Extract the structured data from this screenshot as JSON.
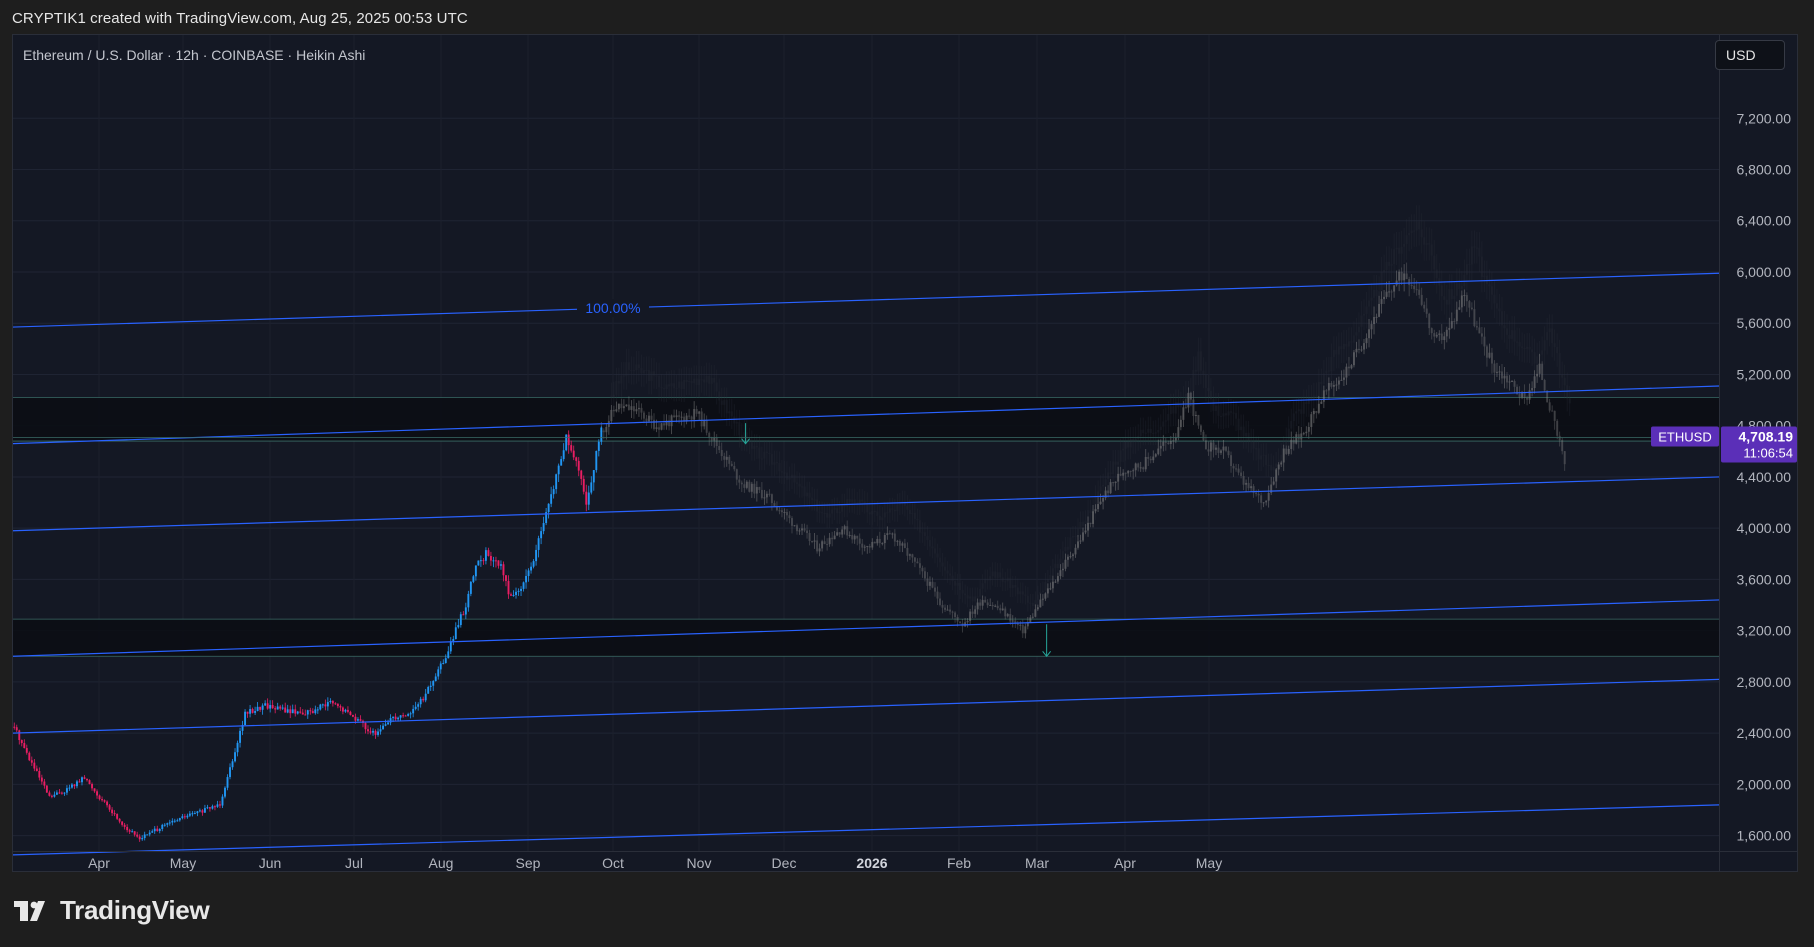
{
  "header": {
    "caption": "CRYPTIK1 created with TradingView.com, Aug 25, 2025 00:53 UTC"
  },
  "chart": {
    "symbol_title": "Ethereum / U.S. Dollar · 12h · COINBASE · Heikin Ashi",
    "currency_button": "USD",
    "price_tag_symbol": "ETHUSD",
    "price_tag_value": "4,708.19",
    "price_tag_countdown": "11:06:54",
    "fib_label": "100.00%",
    "colors": {
      "background": "#141824",
      "channel_line": "#2962ff",
      "up_candle": "#2196f3",
      "down_candle": "#e91e63",
      "projection": "#8c8c8c",
      "price_tag": "#5b2fb8"
    }
  },
  "chart_data": {
    "type": "candlestick",
    "title": "Ethereum / U.S. Dollar · 12h · COINBASE · Heikin Ashi",
    "y_ticks": [
      7200,
      6800,
      6400,
      6000,
      5600,
      5200,
      4800,
      4400,
      4000,
      3600,
      3200,
      2800,
      2400,
      2000,
      1600
    ],
    "y_tick_labels": [
      "7,200.00",
      "6,800.00",
      "6,400.00",
      "6,000.00",
      "5,600.00",
      "5,200.00",
      "4,800.00",
      "4,400.00",
      "4,000.00",
      "3,600.00",
      "3,200.00",
      "2,800.00",
      "2,400.00",
      "2,000.00",
      "1,600.00"
    ],
    "ylim": [
      1480,
      7850
    ],
    "x_labels": [
      "Apr",
      "May",
      "Jun",
      "Jul",
      "Aug",
      "Sep",
      "Oct",
      "Nov",
      "Dec",
      "2026",
      "Feb",
      "Mar",
      "Apr",
      "May"
    ],
    "last_price": 4708.19,
    "actual_path": [
      [
        0,
        2450
      ],
      [
        6,
        2200
      ],
      [
        14,
        1900
      ],
      [
        20,
        1950
      ],
      [
        28,
        2050
      ],
      [
        36,
        1850
      ],
      [
        45,
        1650
      ],
      [
        50,
        1580
      ],
      [
        60,
        1680
      ],
      [
        68,
        1750
      ],
      [
        76,
        1800
      ],
      [
        82,
        1850
      ],
      [
        92,
        2550
      ],
      [
        100,
        2620
      ],
      [
        110,
        2570
      ],
      [
        118,
        2560
      ],
      [
        126,
        2640
      ],
      [
        136,
        2520
      ],
      [
        144,
        2380
      ],
      [
        150,
        2520
      ],
      [
        158,
        2560
      ],
      [
        164,
        2700
      ],
      [
        172,
        3000
      ],
      [
        180,
        3400
      ],
      [
        184,
        3700
      ],
      [
        188,
        3800
      ],
      [
        194,
        3700
      ],
      [
        198,
        3450
      ],
      [
        204,
        3600
      ],
      [
        210,
        3950
      ],
      [
        216,
        4400
      ],
      [
        220,
        4700
      ],
      [
        224,
        4500
      ],
      [
        228,
        4200
      ],
      [
        234,
        4750
      ]
    ],
    "projection_path": [
      [
        234,
        4750
      ],
      [
        240,
        4950
      ],
      [
        248,
        4920
      ],
      [
        256,
        4800
      ],
      [
        264,
        4850
      ],
      [
        272,
        4900
      ],
      [
        280,
        4650
      ],
      [
        290,
        4350
      ],
      [
        300,
        4250
      ],
      [
        310,
        4050
      ],
      [
        320,
        3850
      ],
      [
        330,
        4000
      ],
      [
        340,
        3850
      ],
      [
        350,
        3950
      ],
      [
        360,
        3700
      ],
      [
        370,
        3400
      ],
      [
        378,
        3250
      ],
      [
        386,
        3450
      ],
      [
        394,
        3350
      ],
      [
        402,
        3200
      ],
      [
        410,
        3450
      ],
      [
        418,
        3700
      ],
      [
        426,
        3950
      ],
      [
        434,
        4250
      ],
      [
        442,
        4450
      ],
      [
        450,
        4500
      ],
      [
        458,
        4650
      ],
      [
        464,
        4750
      ],
      [
        468,
        5050
      ],
      [
        474,
        4650
      ],
      [
        482,
        4600
      ],
      [
        490,
        4350
      ],
      [
        498,
        4200
      ],
      [
        506,
        4600
      ],
      [
        514,
        4750
      ],
      [
        522,
        5050
      ],
      [
        530,
        5200
      ],
      [
        536,
        5400
      ],
      [
        542,
        5650
      ],
      [
        548,
        5850
      ],
      [
        554,
        6000
      ],
      [
        560,
        5850
      ],
      [
        566,
        5450
      ],
      [
        572,
        5550
      ],
      [
        578,
        5850
      ],
      [
        584,
        5500
      ],
      [
        590,
        5250
      ],
      [
        596,
        5150
      ],
      [
        602,
        5000
      ],
      [
        608,
        5250
      ],
      [
        614,
        4800
      ],
      [
        618,
        4500
      ]
    ],
    "channel_lines": [
      {
        "start": 5570,
        "end": 5990,
        "label": "100.00%"
      },
      {
        "start": 4660,
        "end": 5110
      },
      {
        "start": 3980,
        "end": 4400
      },
      {
        "start": 3000,
        "end": 3440
      },
      {
        "start": 2400,
        "end": 2820
      },
      {
        "start": 1450,
        "end": 1840
      }
    ],
    "zones": [
      {
        "from": 4680,
        "to": 5020
      },
      {
        "from": 3000,
        "to": 3290
      }
    ]
  }
}
